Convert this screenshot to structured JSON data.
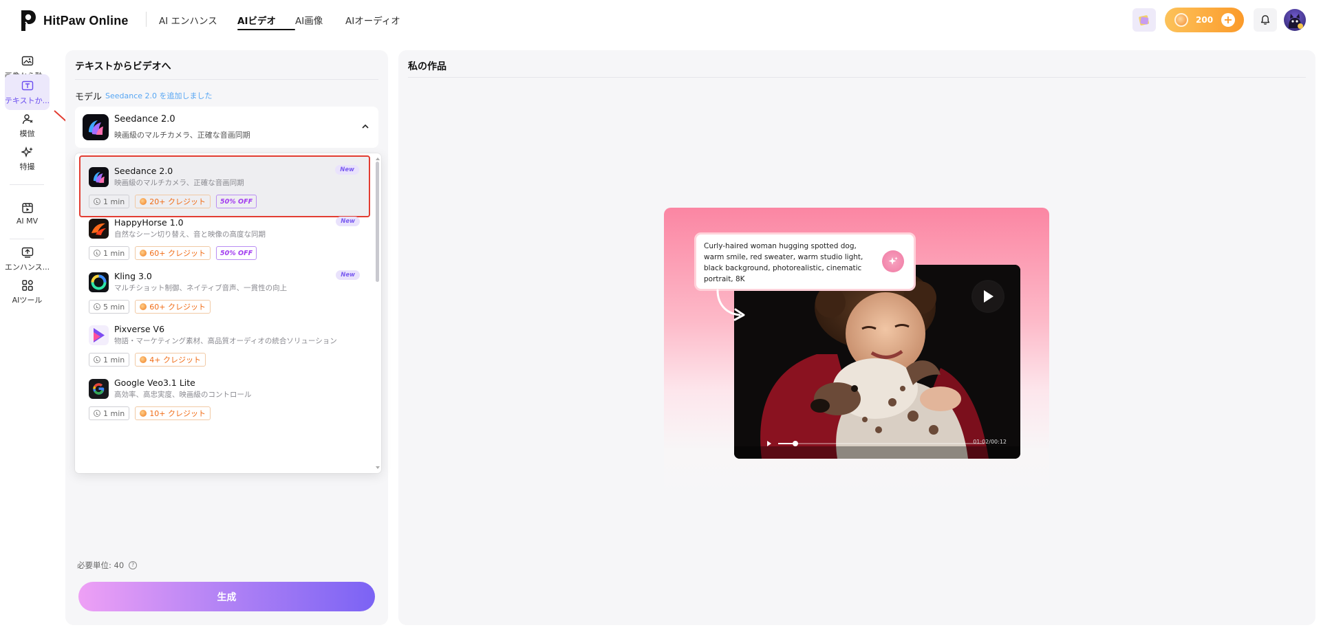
{
  "header": {
    "brand": "HitPaw Online",
    "nav": [
      {
        "label": "AI エンハンス",
        "active": false
      },
      {
        "label": "AIビデオ",
        "active": true
      },
      {
        "label": "AI画像",
        "active": false
      },
      {
        "label": "AIオーディオ",
        "active": false
      }
    ],
    "credits": "200"
  },
  "rail": [
    {
      "label": "画像から動...",
      "icon": "image-to-video-icon",
      "active": false
    },
    {
      "label": "テキストか...",
      "icon": "text-to-video-icon",
      "active": true
    },
    {
      "label": "模倣",
      "icon": "imitate-icon",
      "active": false
    },
    {
      "label": "特撮",
      "icon": "effects-icon",
      "active": false
    },
    {
      "label": "AI MV",
      "icon": "music-video-icon",
      "active": false
    },
    {
      "label": "エンハンス...",
      "icon": "enhance-icon",
      "active": false
    },
    {
      "label": "AIツール",
      "icon": "ai-tools-icon",
      "active": false
    }
  ],
  "left_panel": {
    "title": "テキストからビデオへ",
    "model_label": "モデル",
    "model_note": "Seedance 2.0 を追加しました",
    "selected": {
      "name": "Seedance 2.0",
      "desc": "映画級のマルチカメラ、正確な音画同期"
    },
    "models": [
      {
        "name": "Seedance 2.0",
        "desc": "映画級のマルチカメラ、正確な音画同期",
        "time": "1 min",
        "credits": "20+ クレジット",
        "discount": "50% OFF",
        "badge": "New",
        "icon": "seedance-icon"
      },
      {
        "name": "HappyHorse 1.0",
        "desc": "自然なシーン切り替え、音と映像の高度な同期",
        "time": "1 min",
        "credits": "60+ クレジット",
        "discount": "50% OFF",
        "badge": "New",
        "icon": "happyhorse-icon"
      },
      {
        "name": "Kling 3.0",
        "desc": "マルチショット制御、ネイティブ音声、一貫性の向上",
        "time": "5 min",
        "credits": "60+ クレジット",
        "discount": "",
        "badge": "New",
        "icon": "kling-icon"
      },
      {
        "name": "Pixverse V6",
        "desc": "物語・マーケティング素材、高品質オーディオの統合ソリューション",
        "time": "1 min",
        "credits": "4+ クレジット",
        "discount": "",
        "badge": "",
        "icon": "pixverse-icon"
      },
      {
        "name": "Google Veo3.1 Lite",
        "desc": "高効率、高忠実度、映画級のコントロール",
        "time": "1 min",
        "credits": "10+ クレジット",
        "discount": "",
        "badge": "",
        "icon": "google-icon"
      }
    ],
    "required_units": "必要単位: 40",
    "generate": "生成"
  },
  "right_panel": {
    "title": "私の作品",
    "prompt": "Curly-haired woman hugging spotted dog, warm smile, red sweater, warm studio light, black background, photorealistic, cinematic portrait, 8K",
    "video_time": "01:02/00:12"
  },
  "colors": {
    "accent": "#7b63f4",
    "highlight_border": "#e23c31",
    "credit": "#f06c16"
  }
}
